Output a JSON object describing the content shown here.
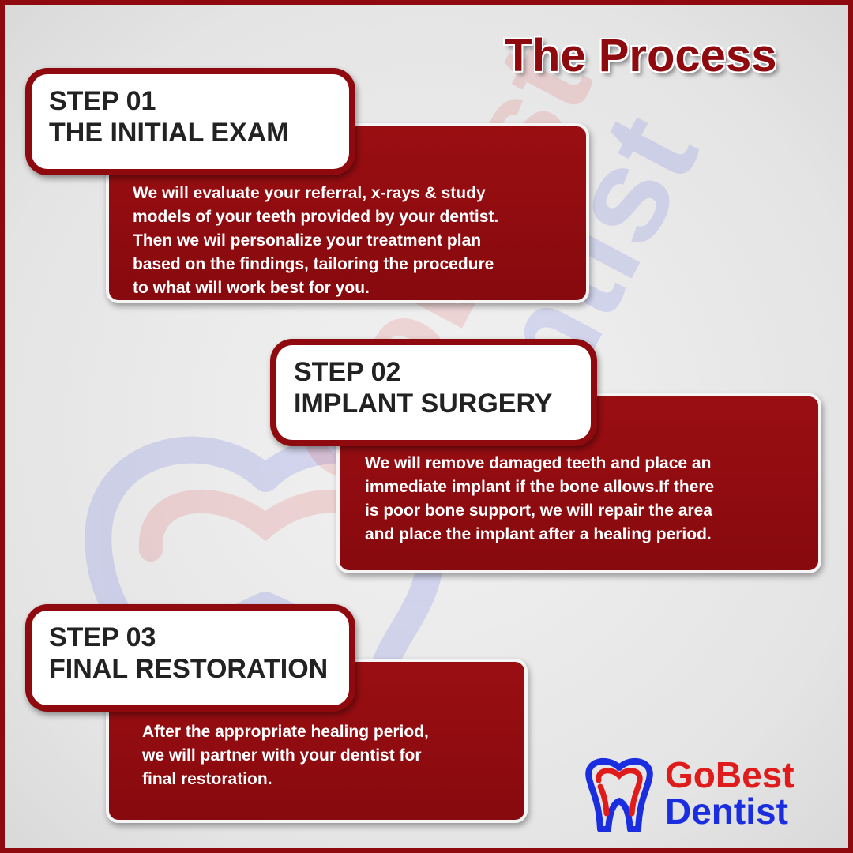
{
  "title": "The Process",
  "colors": {
    "brand_red": "#8e0a0e",
    "logo_red": "#e01b1b",
    "logo_blue": "#1a2ee0"
  },
  "steps": [
    {
      "number": "STEP 01",
      "name": "THE INITIAL EXAM",
      "lines": [
        "We will evaluate your referral, x-rays & study",
        "models of your teeth provided by your dentist.",
        "Then we wil personalize your treatment plan",
        "based on the findings, tailoring the procedure",
        "to what will work best for you."
      ]
    },
    {
      "number": "STEP 02",
      "name": "IMPLANT SURGERY",
      "lines": [
        "We will remove damaged teeth and place an",
        "immediate implant if the bone allows.If there",
        "is poor bone support, we will repair the area",
        "and place the implant after a healing period."
      ]
    },
    {
      "number": "STEP 03",
      "name": "FINAL RESTORATION",
      "lines": [
        "After the appropriate healing period,",
        "we will partner with your dentist for",
        "final restoration."
      ]
    }
  ],
  "logo": {
    "line1": "GoBest",
    "line2": "Dentist",
    "icon": "tooth-icon"
  },
  "watermark": {
    "line1": "GoBest",
    "line2": "Dentist",
    "icon": "tooth-icon"
  }
}
